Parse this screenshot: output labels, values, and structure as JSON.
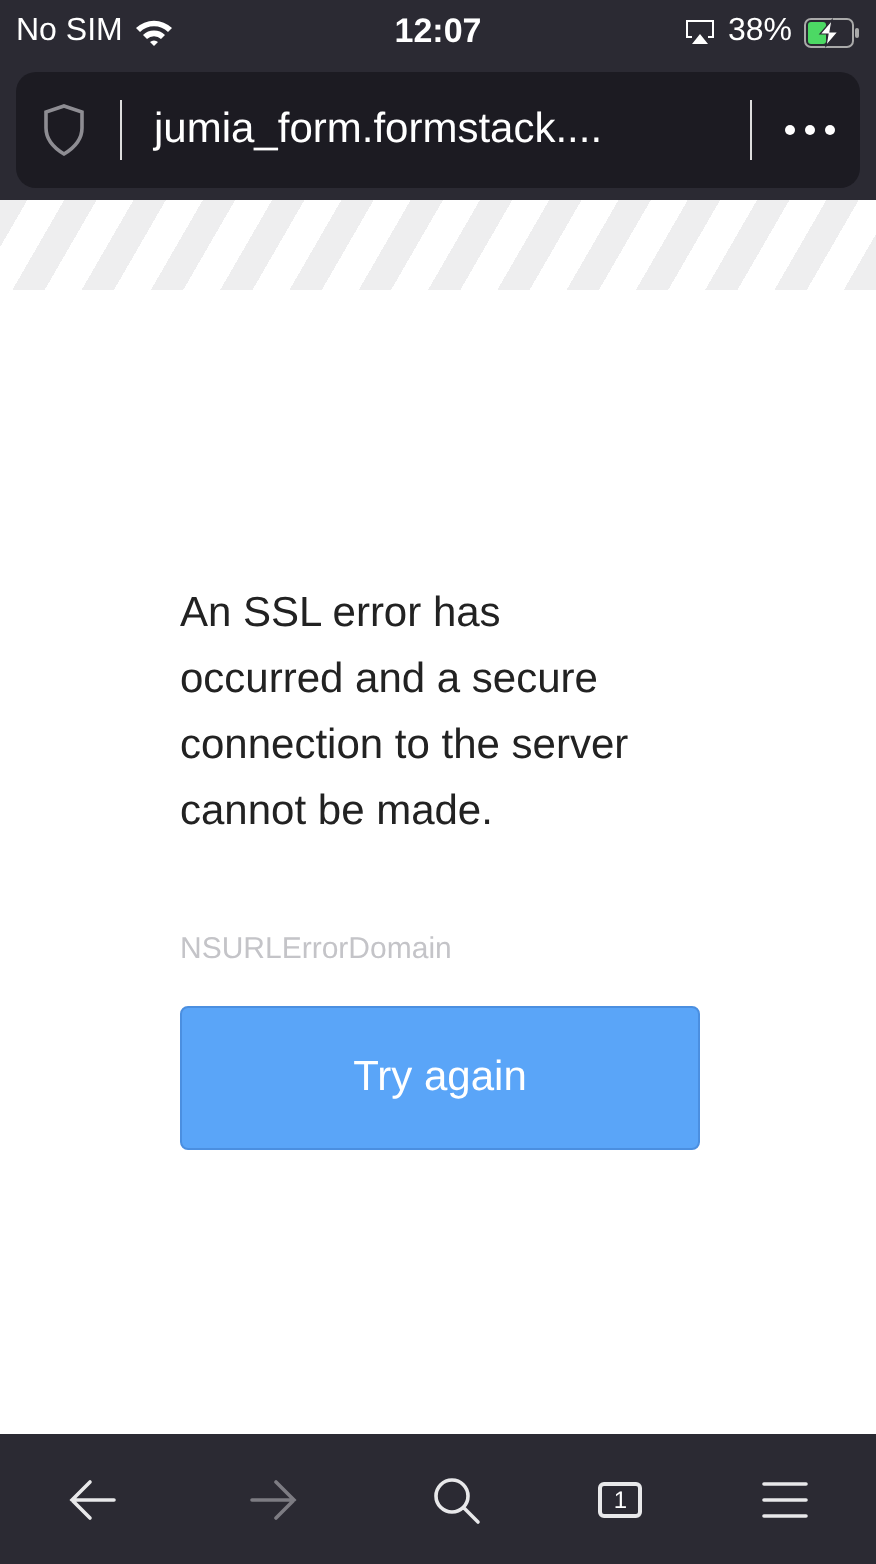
{
  "status_bar": {
    "carrier": "No SIM",
    "time": "12:07",
    "battery": "38%"
  },
  "address_bar": {
    "url": "jumia_form.formstack...."
  },
  "error": {
    "message": "An SSL error has occurred and a secure connection to the server cannot be made.",
    "domain": "NSURLErrorDomain",
    "button": "Try again"
  },
  "toolbar": {
    "back_disabled": false,
    "forward_disabled": true,
    "tab_count": "1"
  }
}
